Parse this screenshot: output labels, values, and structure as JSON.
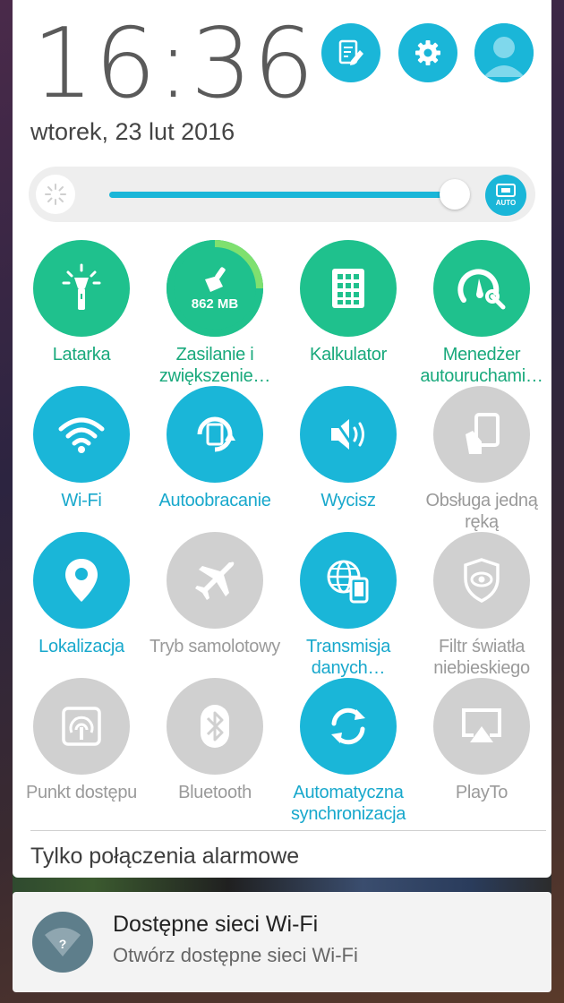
{
  "clock": {
    "time": "16:36",
    "date": "wtorek, 23 lut 2016"
  },
  "top_buttons": [
    {
      "name": "edit-icon"
    },
    {
      "name": "gear-icon"
    },
    {
      "name": "user-avatar"
    }
  ],
  "brightness": {
    "level": 0.92,
    "auto_label": "AUTO"
  },
  "tiles": [
    {
      "label": "Latarka",
      "state": "on"
    },
    {
      "label": "Zasilanie i zwiększenie…",
      "state": "on",
      "badge": "862 MB"
    },
    {
      "label": "Kalkulator",
      "state": "on"
    },
    {
      "label": "Menedżer autouruchami…",
      "state": "on"
    },
    {
      "label": "Wi-Fi",
      "state": "on"
    },
    {
      "label": "Autoobracanie",
      "state": "on"
    },
    {
      "label": "Wycisz",
      "state": "on"
    },
    {
      "label": "Obsługa jedną ręką",
      "state": "off"
    },
    {
      "label": "Lokalizacja",
      "state": "on"
    },
    {
      "label": "Tryb samolotowy",
      "state": "off"
    },
    {
      "label": "Transmisja danych…",
      "state": "on"
    },
    {
      "label": "Filtr światła niebieskiego",
      "state": "off"
    },
    {
      "label": "Punkt dostępu",
      "state": "off"
    },
    {
      "label": "Bluetooth",
      "state": "off"
    },
    {
      "label": "Automatyczna synchronizacja",
      "state": "on"
    },
    {
      "label": "PlayTo",
      "state": "off"
    }
  ],
  "status": {
    "network_text": "Tylko połączenia alarmowe"
  },
  "notification": {
    "title": "Dostępne sieci Wi-Fi",
    "text": "Otwórz dostępne sieci Wi-Fi",
    "icon_glyph": "?"
  },
  "colors": {
    "accent_blue": "#1ab6d8",
    "accent_green": "#1fc18d",
    "inactive": "#d0d0d0"
  }
}
